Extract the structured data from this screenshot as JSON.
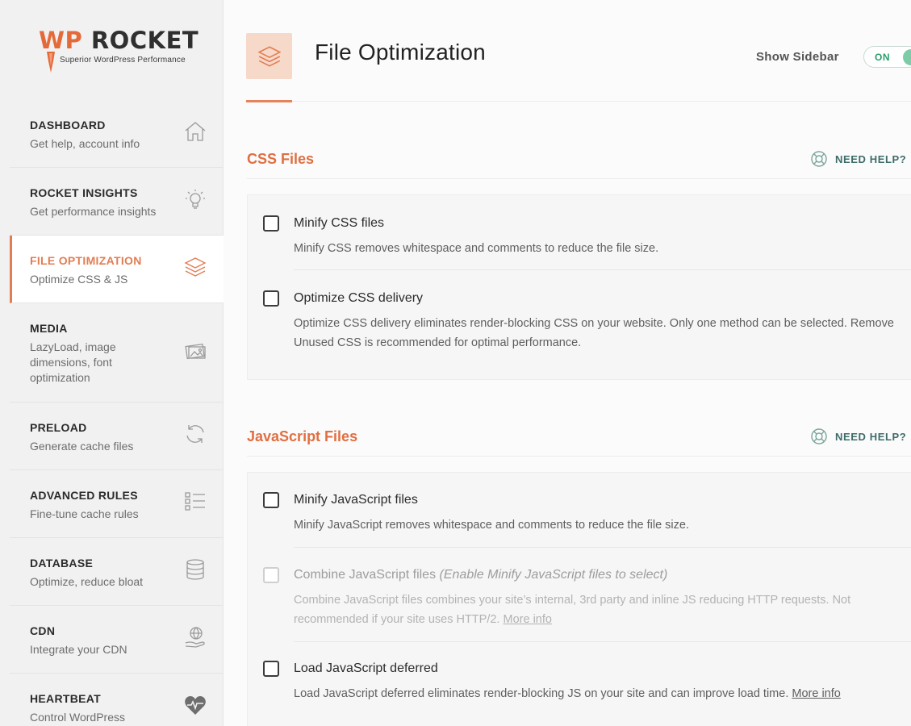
{
  "logo": {
    "wp": "WP",
    "rocket": " ROCKET",
    "tagline": "Superior WordPress Performance",
    "accent": "#e56a3a"
  },
  "sidebar": {
    "items": [
      {
        "title": "DASHBOARD",
        "sub": "Get help, account info",
        "icon": "home-icon"
      },
      {
        "title": "ROCKET INSIGHTS",
        "sub": "Get performance insights",
        "icon": "lightbulb-icon"
      },
      {
        "title": "FILE OPTIMIZATION",
        "sub": "Optimize CSS & JS",
        "icon": "layers-icon"
      },
      {
        "title": "MEDIA",
        "sub": "LazyLoad, image dimensions, font optimization",
        "icon": "images-icon"
      },
      {
        "title": "PRELOAD",
        "sub": "Generate cache files",
        "icon": "refresh-icon"
      },
      {
        "title": "ADVANCED RULES",
        "sub": "Fine-tune cache rules",
        "icon": "checklist-icon"
      },
      {
        "title": "DATABASE",
        "sub": "Optimize, reduce bloat",
        "icon": "database-icon"
      },
      {
        "title": "CDN",
        "sub": "Integrate your CDN",
        "icon": "globe-hand-icon"
      },
      {
        "title": "HEARTBEAT",
        "sub": "Control WordPress",
        "icon": "heartbeat-icon"
      }
    ],
    "active_index": 2
  },
  "header": {
    "title": "File Optimization",
    "show_sidebar": "Show Sidebar",
    "toggle": "ON",
    "accent": "#e5835a"
  },
  "sections": {
    "css": {
      "title": "CSS Files",
      "help": "NEED HELP?",
      "options": [
        {
          "title": "Minify CSS files",
          "desc": "Minify CSS removes whitespace and comments to reduce the file size."
        },
        {
          "title": "Optimize CSS delivery",
          "desc": "Optimize CSS delivery eliminates render-blocking CSS on your website. Only one method can be selected. Remove Unused CSS is recommended for optimal performance."
        }
      ]
    },
    "js": {
      "title": "JavaScript Files",
      "help": "NEED HELP?",
      "options": [
        {
          "title": "Minify JavaScript files",
          "desc": "Minify JavaScript removes whitespace and comments to reduce the file size."
        },
        {
          "title": "Combine JavaScript files",
          "title_note": "(Enable Minify JavaScript files to select)",
          "desc": "Combine JavaScript files combines your site’s internal, 3rd party and inline JS reducing HTTP requests. Not recommended if your site uses HTTP/2.",
          "link": "More info",
          "disabled": true
        },
        {
          "title": "Load JavaScript deferred",
          "desc": "Load JavaScript deferred eliminates render-blocking JS on your site and can improve load time.",
          "link": "More info"
        }
      ]
    }
  }
}
